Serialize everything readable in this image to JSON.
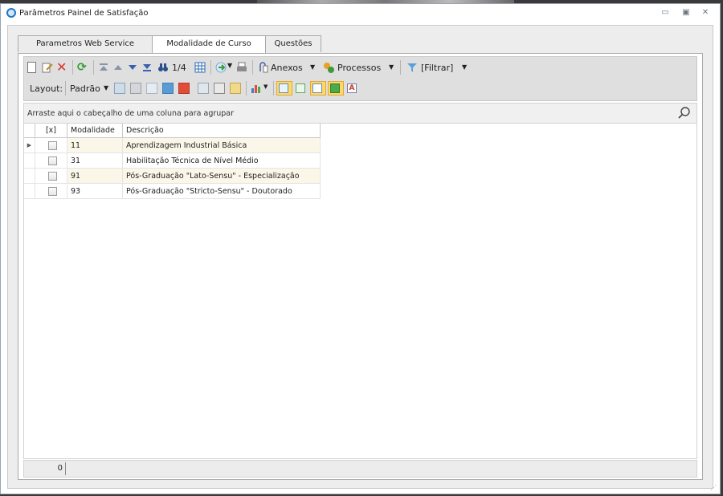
{
  "window": {
    "title": "Parâmetros Painel de Satisfação",
    "controls": [
      "minimize",
      "restore",
      "close"
    ]
  },
  "tabs": [
    {
      "label": "Parametros Web Service",
      "active": false
    },
    {
      "label": "Modalidade de Curso",
      "active": true
    },
    {
      "label": "Questões",
      "active": false
    }
  ],
  "toolbar": {
    "record_counter": "1/4",
    "anexos_label": "Anexos",
    "processos_label": "Processos",
    "filtrar_label": "[Filtrar]",
    "layout_label": "Layout:",
    "padrao_label": "Padrão"
  },
  "groupbar": {
    "text": "Arraste aqui o cabeçalho de uma coluna para agrupar"
  },
  "grid": {
    "columns": [
      "[x]",
      "Modalidade",
      "Descrição"
    ],
    "rows": [
      {
        "modalidade": "11",
        "descricao": "Aprendizagem Industrial Básica",
        "checked": false,
        "current": true
      },
      {
        "modalidade": "31",
        "descricao": "Habilitação Técnica de Nível Médio",
        "checked": false,
        "current": false
      },
      {
        "modalidade": "91",
        "descricao": "Pós-Graduação \"Lato-Sensu\" - Especialização",
        "checked": false,
        "current": false
      },
      {
        "modalidade": "93",
        "descricao": "Pós-Graduação \"Stricto-Sensu\" - Doutorado",
        "checked": false,
        "current": false
      }
    ]
  },
  "footer": {
    "count": "0"
  },
  "colors": {
    "accent": "#1f76c5",
    "row_highlight": "#fbf7e8",
    "delete_red": "#d9342b",
    "refresh_green": "#2e9b2e",
    "toolbar_bg": "#dfdfdf"
  }
}
